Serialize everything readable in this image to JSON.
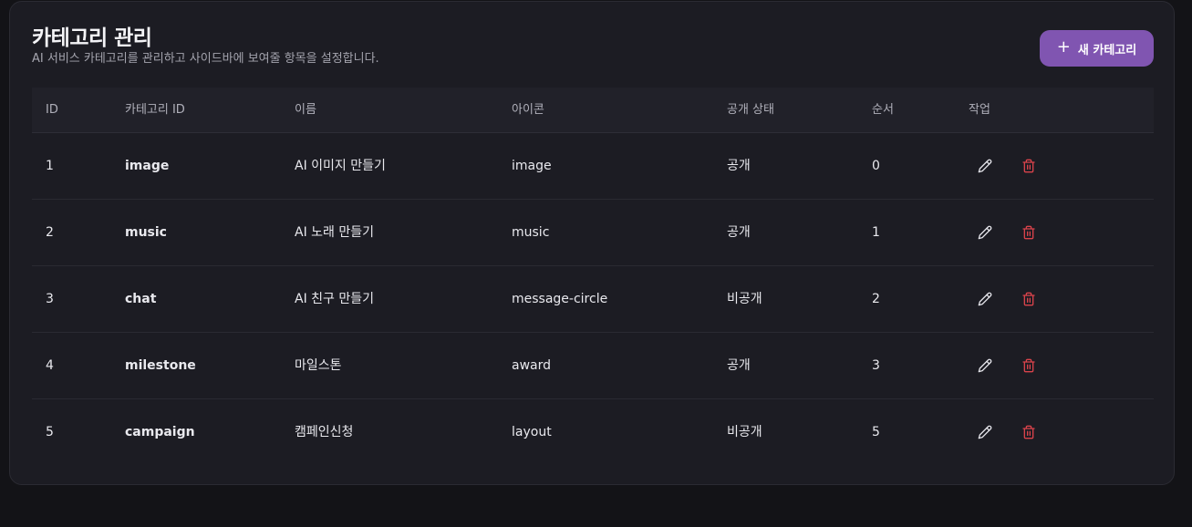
{
  "header": {
    "title": "카테고리 관리",
    "subtitle": "AI 서비스 카테고리를 관리하고 사이드바에 보여줄 항목을 설정합니다.",
    "add_button_icon": "+",
    "add_button_label": "새 카테고리"
  },
  "table": {
    "columns": [
      "ID",
      "카테고리 ID",
      "이름",
      "아이콘",
      "공개 상태",
      "순서",
      "작업"
    ],
    "rows": [
      {
        "id": "1",
        "category_id": "image",
        "name": "AI 이미지 만들기",
        "icon": "image",
        "status": "공개",
        "order": "0"
      },
      {
        "id": "2",
        "category_id": "music",
        "name": "AI 노래 만들기",
        "icon": "music",
        "status": "공개",
        "order": "1"
      },
      {
        "id": "3",
        "category_id": "chat",
        "name": "AI 친구 만들기",
        "icon": "message-circle",
        "status": "비공개",
        "order": "2"
      },
      {
        "id": "4",
        "category_id": "milestone",
        "name": "마일스톤",
        "icon": "award",
        "status": "공개",
        "order": "3"
      },
      {
        "id": "5",
        "category_id": "campaign",
        "name": "캠페인신청",
        "icon": "layout",
        "status": "비공개",
        "order": "5"
      }
    ],
    "action_icons": [
      "pencil-icon",
      "trash-icon"
    ]
  },
  "colors": {
    "accent": "#8055b1",
    "delete": "#d9434b",
    "background": "#131317",
    "card": "#1c1c23"
  }
}
